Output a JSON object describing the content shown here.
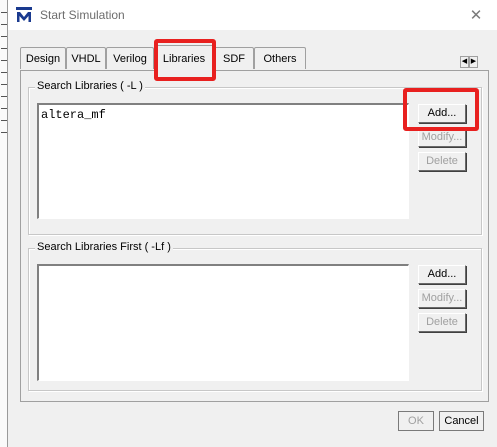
{
  "window": {
    "title": "Start Simulation",
    "icon": "modelsim-logo-icon",
    "close_icon": "close-icon"
  },
  "tabs": [
    {
      "label": "Design"
    },
    {
      "label": "VHDL"
    },
    {
      "label": "Verilog"
    },
    {
      "label": "Libraries",
      "active": true
    },
    {
      "label": "SDF"
    },
    {
      "label": "Others"
    }
  ],
  "tab_scroll": {
    "left": "◀",
    "right": "▶"
  },
  "search_libraries": {
    "label": "Search Libraries ( -L )",
    "items": [
      "altera_mf"
    ],
    "buttons": {
      "add": "Add...",
      "modify": "Modify...",
      "delete": "Delete"
    }
  },
  "search_libraries_first": {
    "label": "Search Libraries First ( -Lf )",
    "items": [],
    "buttons": {
      "add": "Add...",
      "modify": "Modify...",
      "delete": "Delete"
    }
  },
  "footer": {
    "ok": "OK",
    "cancel": "Cancel"
  },
  "colors": {
    "highlight": "#e8201f",
    "dialog_bg": "#f0f0f0"
  }
}
